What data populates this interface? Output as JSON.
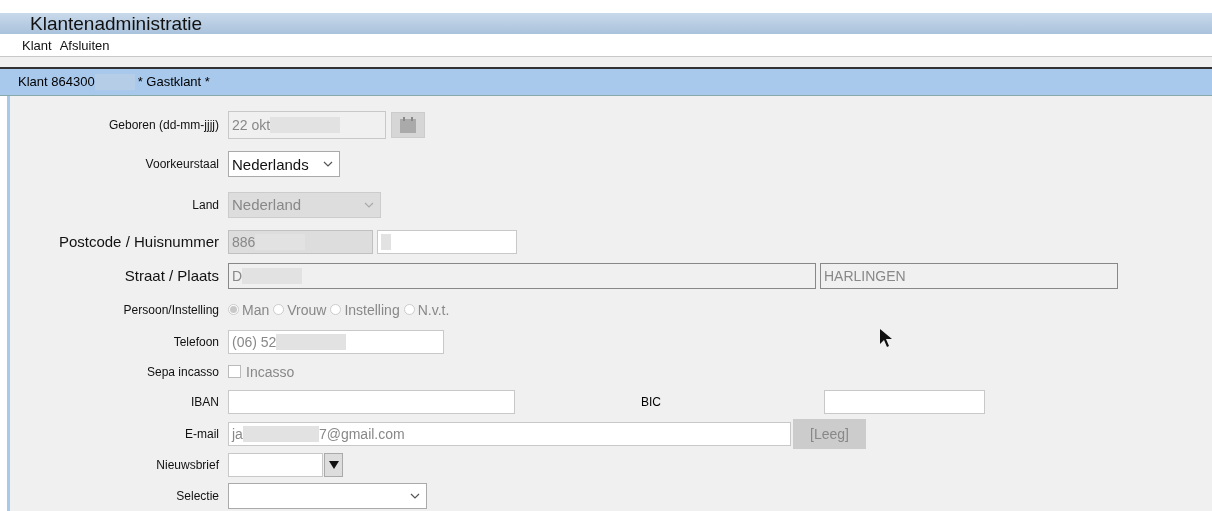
{
  "window": {
    "title": "Klantenadministratie"
  },
  "menu": [
    {
      "label": "Klant"
    },
    {
      "label": "Afsluiten"
    }
  ],
  "header": {
    "prefix": "Klant 864300",
    "suffix": "* Gastklant *"
  },
  "form": [
    {
      "kind": "date",
      "label": "Geboren (dd-mm-jjjj)",
      "value": "22 okt",
      "disabled": true
    },
    {
      "kind": "select",
      "label": "Voorkeurstaal",
      "value": "Nederlands",
      "disabled": false
    },
    {
      "kind": "select",
      "label": "Land",
      "value": "Nederland",
      "disabled": true
    },
    {
      "kind": "pair",
      "label": "Postcode / Huisnummer",
      "value": "886"
    },
    {
      "kind": "pair",
      "label": "Straat / Plaats",
      "value": "D",
      "value_2": "HARLINGEN"
    },
    {
      "kind": "radio",
      "label": "Persoon/Instelling",
      "disabled": true,
      "options": [
        {
          "label": "Man",
          "selected": true
        },
        {
          "label": "Vrouw",
          "selected": false
        },
        {
          "label": "Instelling",
          "selected": false
        },
        {
          "label": "N.v.t.",
          "selected": false
        }
      ]
    },
    {
      "kind": "text",
      "label": "Telefoon",
      "value": "(06) 52"
    },
    {
      "kind": "checkbox",
      "label": "Sepa incasso",
      "option": "Incasso",
      "checked": false
    },
    {
      "kind": "iban_bic",
      "label": "IBAN",
      "label_2": "BIC"
    },
    {
      "kind": "email",
      "label": "E-mail",
      "value": "ja",
      "value_end": "7@gmail.com",
      "button": "[Leeg]"
    },
    {
      "kind": "combo",
      "label": "Nieuwsbrief"
    },
    {
      "kind": "select",
      "label": "Selectie",
      "disabled": false
    }
  ]
}
